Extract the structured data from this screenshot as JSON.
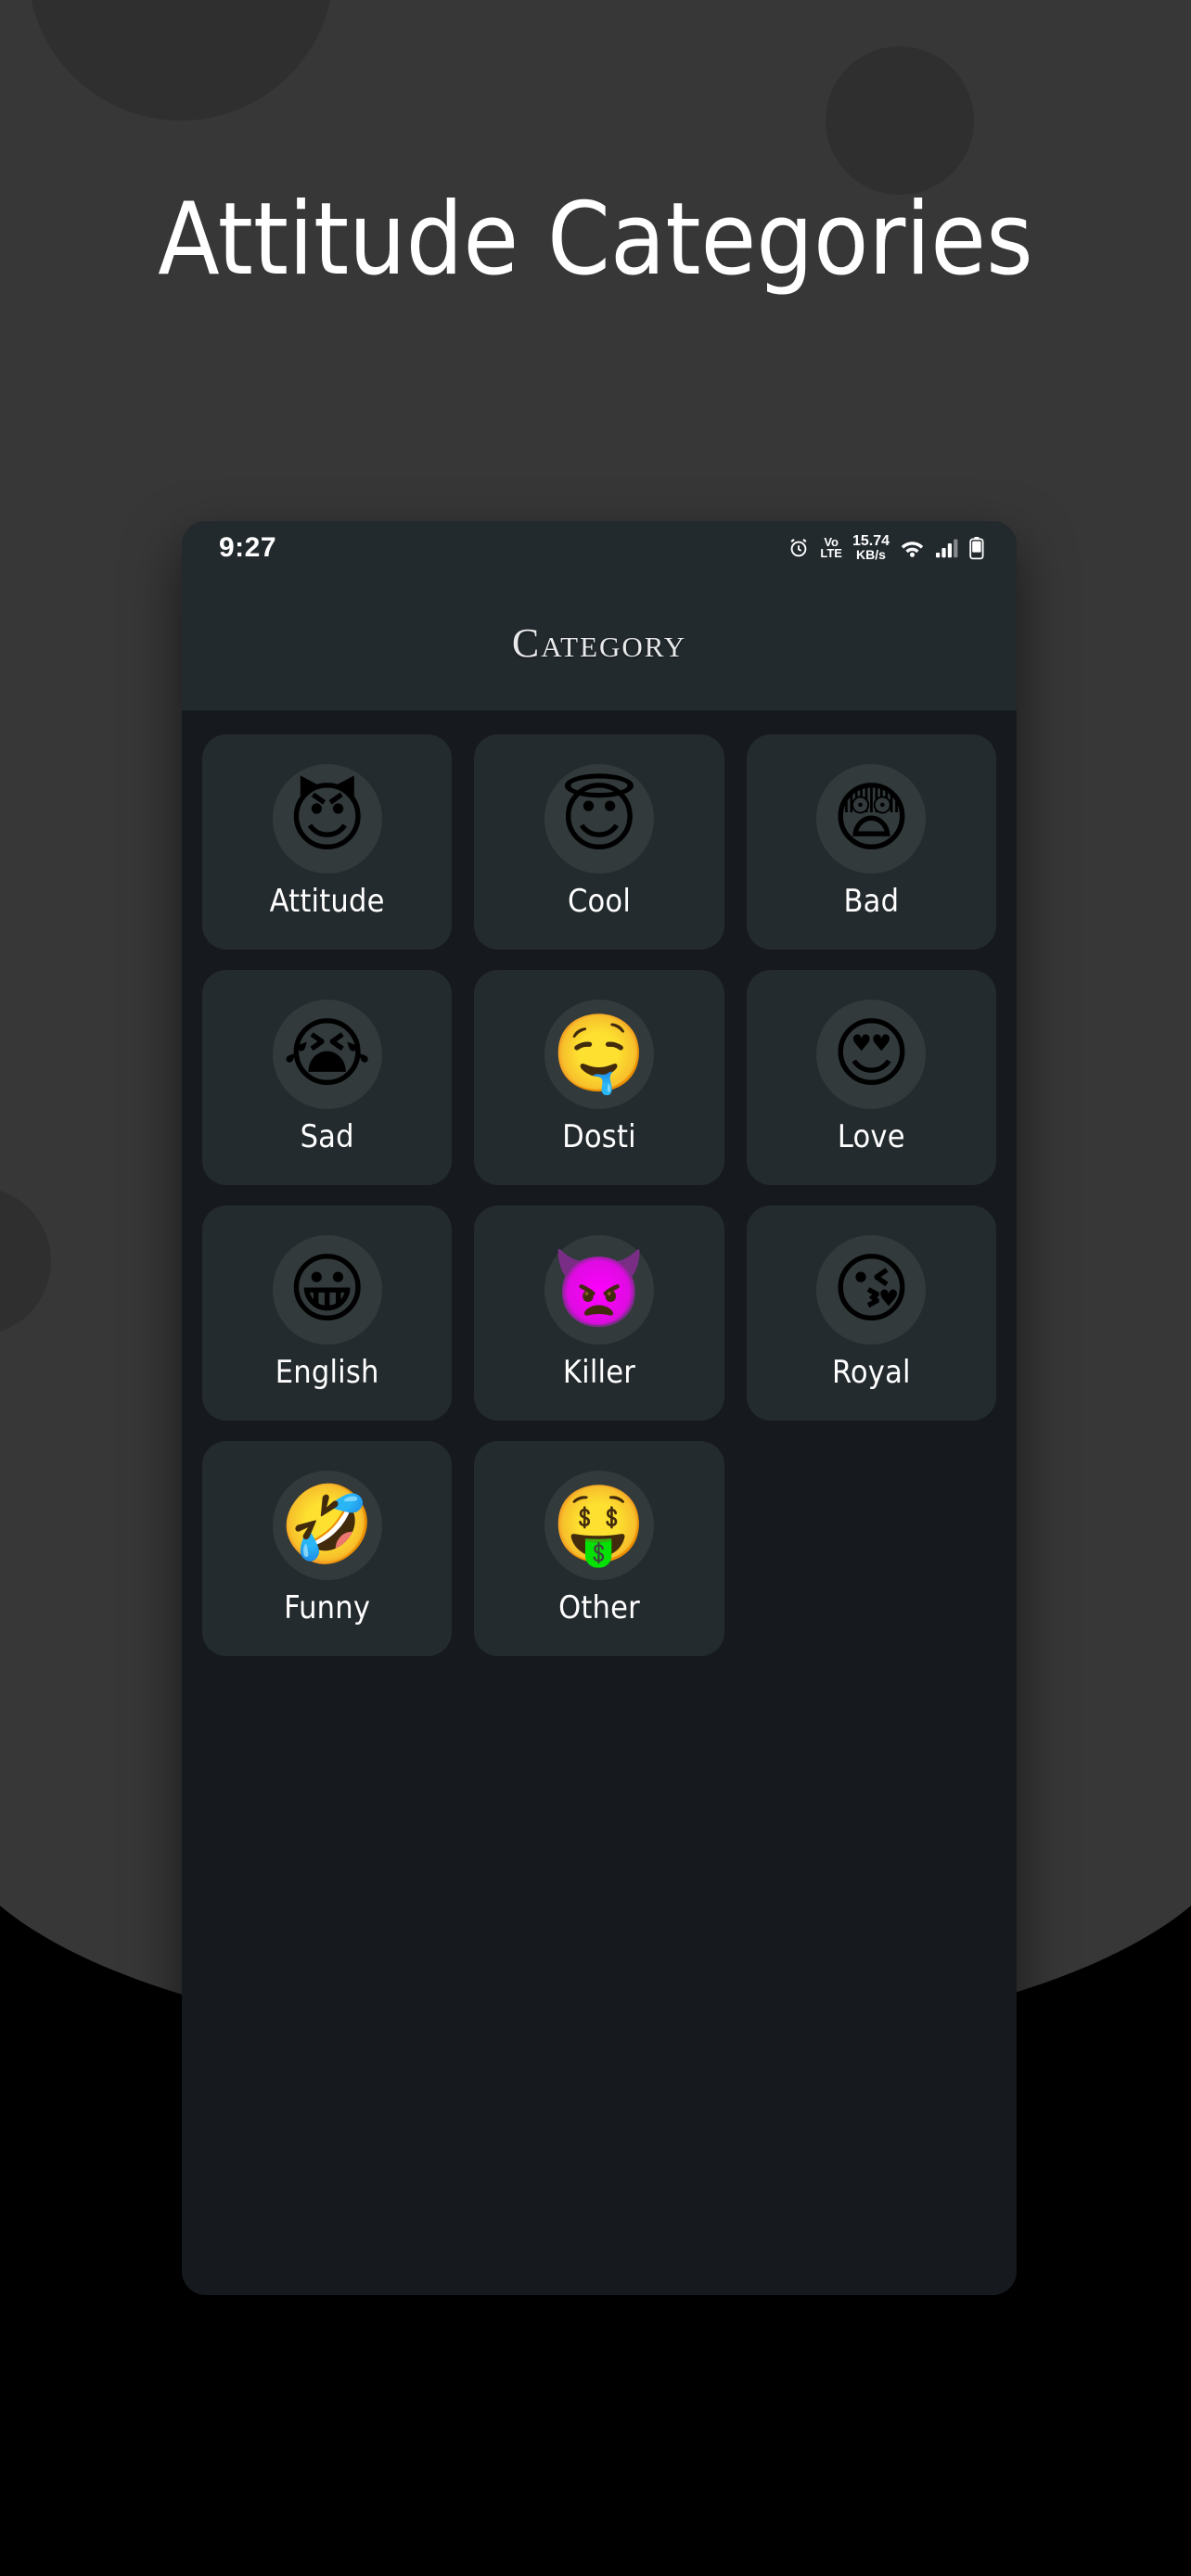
{
  "page": {
    "headline": "Attitude Categories",
    "background_color": "#000000",
    "panel_color": "#373737",
    "blob_color": "#2f2f2f"
  },
  "phone": {
    "screen_bg": "#161a1f",
    "header_bg": "#232a2e",
    "tile_bg": "#242b2e",
    "accent_text": "#ffffff",
    "status_bar": {
      "time": "9:27",
      "alarm_icon": "alarm-clock-icon",
      "volte_top": "Vo",
      "volte_bottom": "LTE",
      "net_speed_value": "15.74",
      "net_speed_unit": "KB/s",
      "wifi_icon": "wifi-icon",
      "signal_icon": "cellular-signal-icon",
      "battery_icon": "battery-icon"
    },
    "app_bar": {
      "title": "Category"
    },
    "categories": [
      {
        "label": "Attitude",
        "emoji": "😈",
        "icon_name": "smiling-face-with-horns-emoji"
      },
      {
        "label": "Cool",
        "emoji": "😇",
        "icon_name": "smiling-face-with-halo-emoji"
      },
      {
        "label": "Bad",
        "emoji": "😨",
        "icon_name": "fearful-face-emoji"
      },
      {
        "label": "Sad",
        "emoji": "😭",
        "icon_name": "loudly-crying-face-emoji"
      },
      {
        "label": "Dosti",
        "emoji": "🤤",
        "icon_name": "drooling-face-emoji"
      },
      {
        "label": "Love",
        "emoji": "😍",
        "icon_name": "smiling-face-with-heart-eyes-emoji"
      },
      {
        "label": "English",
        "emoji": "😀",
        "icon_name": "grinning-face-emoji"
      },
      {
        "label": "Killer",
        "emoji": "👿",
        "icon_name": "angry-face-with-horns-emoji"
      },
      {
        "label": "Royal",
        "emoji": "😘",
        "icon_name": "face-blowing-a-kiss-emoji"
      },
      {
        "label": "Funny",
        "emoji": "🤣",
        "icon_name": "rolling-on-the-floor-laughing-emoji"
      },
      {
        "label": "Other",
        "emoji": "🤑",
        "icon_name": "money-mouth-face-emoji"
      }
    ]
  }
}
